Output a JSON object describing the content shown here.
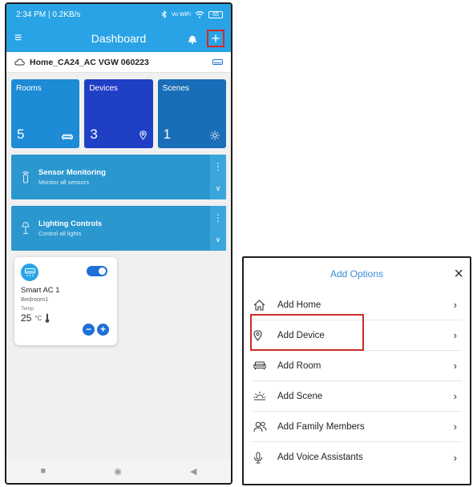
{
  "status_bar": {
    "time_speed": "2:34 PM | 0.2KB/s",
    "network": "Vo WiFi",
    "battery": "65"
  },
  "app_bar": {
    "title": "Dashboard",
    "menu_icon": "hamburger-icon",
    "notification_icon": "bell-icon",
    "add_icon": "plus-icon"
  },
  "home": {
    "name": "Home_CA24_AC VGW 060223"
  },
  "tiles": [
    {
      "label": "Rooms",
      "count": "5",
      "icon": "sofa-icon"
    },
    {
      "label": "Devices",
      "count": "3",
      "icon": "location-pin-icon"
    },
    {
      "label": "Scenes",
      "count": "1",
      "icon": "sun-icon"
    }
  ],
  "panels": [
    {
      "title": "Sensor Monitoring",
      "subtitle": "Monitor all sensors",
      "icon": "sensor-icon"
    },
    {
      "title": "Lighting Controls",
      "subtitle": "Control all lights",
      "icon": "lamp-icon"
    }
  ],
  "device_card": {
    "name": "Smart AC 1",
    "room": "Bedroom1",
    "temp_label": "Temp.",
    "temp_value": "25",
    "temp_unit": "°C",
    "power_on": true
  },
  "add_options": {
    "title": "Add Options",
    "close": "×",
    "items": [
      {
        "label": "Add Home",
        "icon": "home-icon"
      },
      {
        "label": "Add Device",
        "icon": "location-pin-icon"
      },
      {
        "label": "Add Room",
        "icon": "sofa-icon"
      },
      {
        "label": "Add Scene",
        "icon": "sun-icon"
      },
      {
        "label": "Add Family Members",
        "icon": "users-icon"
      },
      {
        "label": "Add Voice Assistants",
        "icon": "microphone-icon"
      }
    ]
  },
  "colors": {
    "primary": "#29a3e6",
    "devices_tile": "#1f3fc4",
    "highlight": "#cc2b2b",
    "toggle_on": "#1e6fd6"
  }
}
